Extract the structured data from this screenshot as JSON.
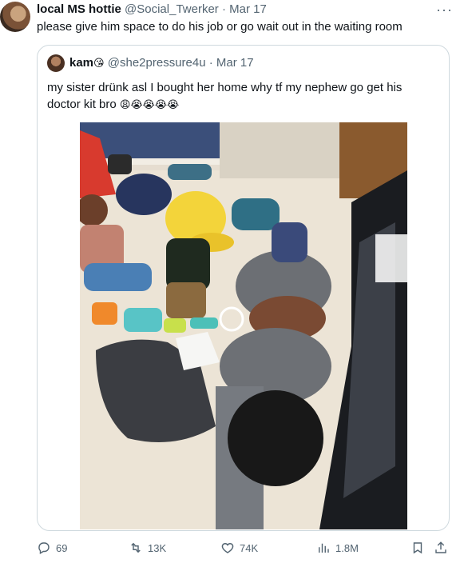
{
  "tweet": {
    "display_name": "local MS hottie",
    "handle": "@Social_Twerker",
    "separator": "·",
    "date": "Mar 17",
    "more": "···",
    "text": "please give him space to do his job or go wait out in the waiting room"
  },
  "quote": {
    "display_name": "kam",
    "name_emoji": "😘",
    "handle": "@she2pressure4u",
    "separator": "·",
    "date": "Mar 17",
    "text_line1": "my sister drünk asl I bought her home why tf my nephew go get his",
    "text_line2": "doctor kit bro",
    "text_emojis": "😩😭😭😭😭"
  },
  "actions": {
    "replies": "69",
    "retweets": "13K",
    "likes": "74K",
    "views": "1.8M"
  },
  "icons": {
    "reply": "reply-icon",
    "retweet": "retweet-icon",
    "like": "heart-icon",
    "views": "views-icon",
    "bookmark": "bookmark-icon",
    "share": "share-icon"
  }
}
